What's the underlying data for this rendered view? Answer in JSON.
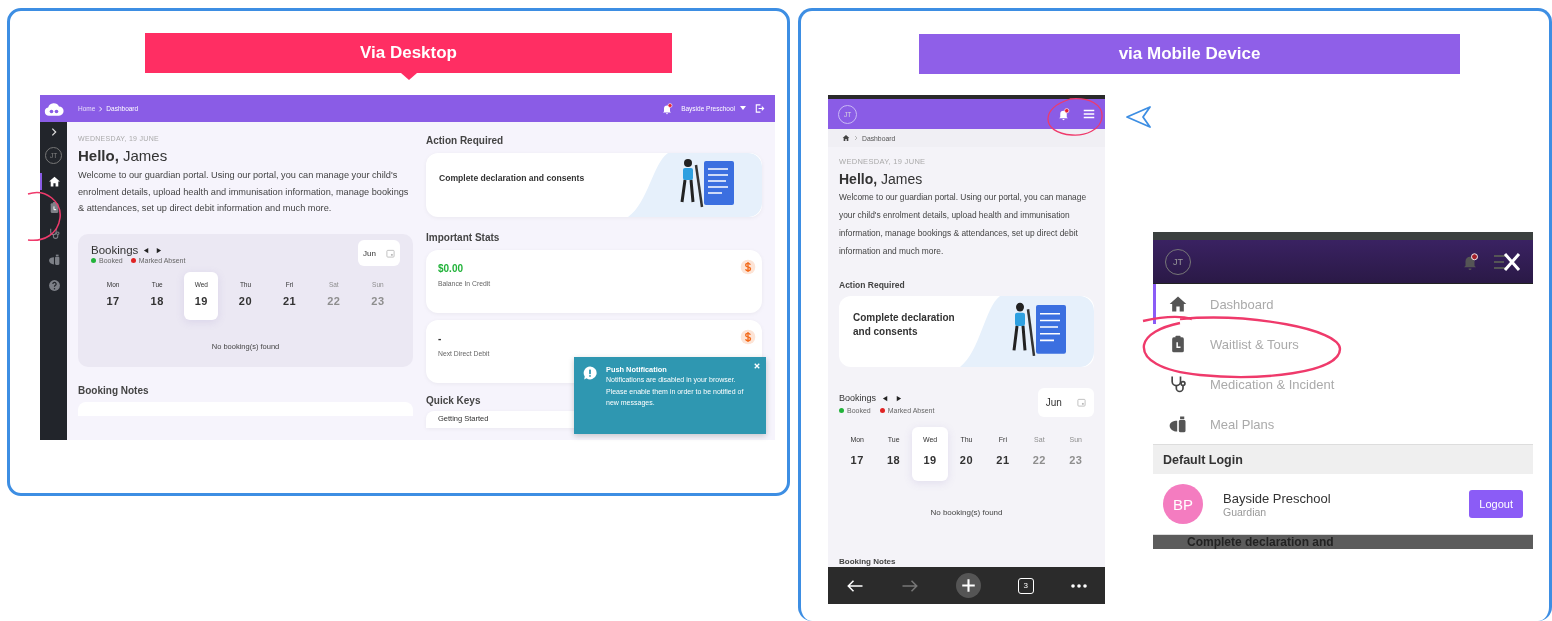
{
  "desktop_panel": {
    "banner": "Via Desktop",
    "screen": {
      "breadcrumb": [
        "Home",
        "Dashboard"
      ],
      "school": "Bayside Preschool",
      "sidebar": {
        "avatar": "JT",
        "items": [
          {
            "kind": "home",
            "selected": true
          },
          {
            "kind": "waitlist",
            "selected": false
          },
          {
            "kind": "medication",
            "selected": false
          },
          {
            "kind": "meal",
            "selected": false
          },
          {
            "kind": "help",
            "selected": false
          }
        ]
      },
      "date": "WEDNESDAY, 19 JUNE",
      "greeting": "**Hello,** James",
      "intro": "Welcome to our guardian portal. Using our portal, you can manage your child's enrolment details, upload health and immunisation information, manage bookings & attendances, set up direct debit information and much more.",
      "bookings": {
        "title": "Bookings",
        "legend": [
          {
            "label": "Booked",
            "color": "#22b33a"
          },
          {
            "label": "Marked Absent",
            "color": "#e02424"
          }
        ],
        "month": "Jun",
        "days": [
          {
            "day": "Mon",
            "date": "17",
            "selected": false,
            "disabled": false
          },
          {
            "day": "Tue",
            "date": "18",
            "selected": false,
            "disabled": false
          },
          {
            "day": "Wed",
            "date": "19",
            "selected": true,
            "disabled": false
          },
          {
            "day": "Thu",
            "date": "20",
            "selected": false,
            "disabled": false
          },
          {
            "day": "Fri",
            "date": "21",
            "selected": false,
            "disabled": false
          },
          {
            "day": "Sat",
            "date": "22",
            "selected": false,
            "disabled": true
          },
          {
            "day": "Sun",
            "date": "23",
            "selected": false,
            "disabled": true
          }
        ],
        "empty": "No booking(s) found"
      },
      "booking_notes": "Booking Notes",
      "action_required": {
        "title": "Action Required",
        "card": "Complete declaration and consents"
      },
      "important_stats": {
        "title": "Important Stats",
        "stats": [
          {
            "value": "$0.00",
            "label": "Balance In Credit",
            "positive": true
          },
          {
            "value": "-",
            "label": "Next Direct Debit",
            "positive": false
          }
        ]
      },
      "quick_keys": {
        "title": "Quick Keys",
        "items": [
          "Getting Started"
        ]
      },
      "toast": {
        "title": "Push Notification",
        "message": "Notifications are disabled in your browser. Please enable them in order to be notified of new messages."
      }
    }
  },
  "mobile_panel": {
    "banner": "via Mobile Device",
    "screen": {
      "avatar": "JT",
      "breadcrumb": [
        "Dashboard"
      ],
      "date": "WEDNESDAY, 19 JUNE",
      "greeting": "**Hello,** James",
      "intro": "Welcome to our guardian portal. Using our portal, you can manage your child's enrolment details, upload health and immunisation information, manage bookings & attendances, set up direct debit information and much more.",
      "action_required": {
        "title": "Action Required",
        "card": "Complete declaration and consents"
      },
      "bookings": {
        "title": "Bookings",
        "legend": [
          {
            "label": "Booked",
            "color": "#22b33a"
          },
          {
            "label": "Marked Absent",
            "color": "#e02424"
          }
        ],
        "month": "Jun",
        "days": [
          {
            "day": "Mon",
            "date": "17",
            "selected": false,
            "disabled": false
          },
          {
            "day": "Tue",
            "date": "18",
            "selected": false,
            "disabled": false
          },
          {
            "day": "Wed",
            "date": "19",
            "selected": true,
            "disabled": false
          },
          {
            "day": "Thu",
            "date": "20",
            "selected": false,
            "disabled": false
          },
          {
            "day": "Fri",
            "date": "21",
            "selected": false,
            "disabled": false
          },
          {
            "day": "Sat",
            "date": "22",
            "selected": false,
            "disabled": true
          },
          {
            "day": "Sun",
            "date": "23",
            "selected": false,
            "disabled": true
          }
        ],
        "empty": "No booking(s) found"
      },
      "booking_notes": "Booking Notes",
      "browser_bar": {
        "forward_disabled": true,
        "tab_count": "3"
      }
    },
    "menu_screen": {
      "avatar": "JT",
      "items": [
        {
          "kind": "home",
          "label": "Dashboard",
          "selected": true
        },
        {
          "kind": "waitlist",
          "label": "Waitlist & Tours",
          "selected": false
        },
        {
          "kind": "medication",
          "label": "Medication & Incident",
          "selected": false
        },
        {
          "kind": "meal",
          "label": "Meal Plans",
          "selected": false
        }
      ],
      "section": "Default Login",
      "account": {
        "initials": "BP",
        "name": "Bayside Preschool",
        "role": "Guardian",
        "button": "Logout"
      },
      "behind_text": "Complete declaration and"
    }
  }
}
